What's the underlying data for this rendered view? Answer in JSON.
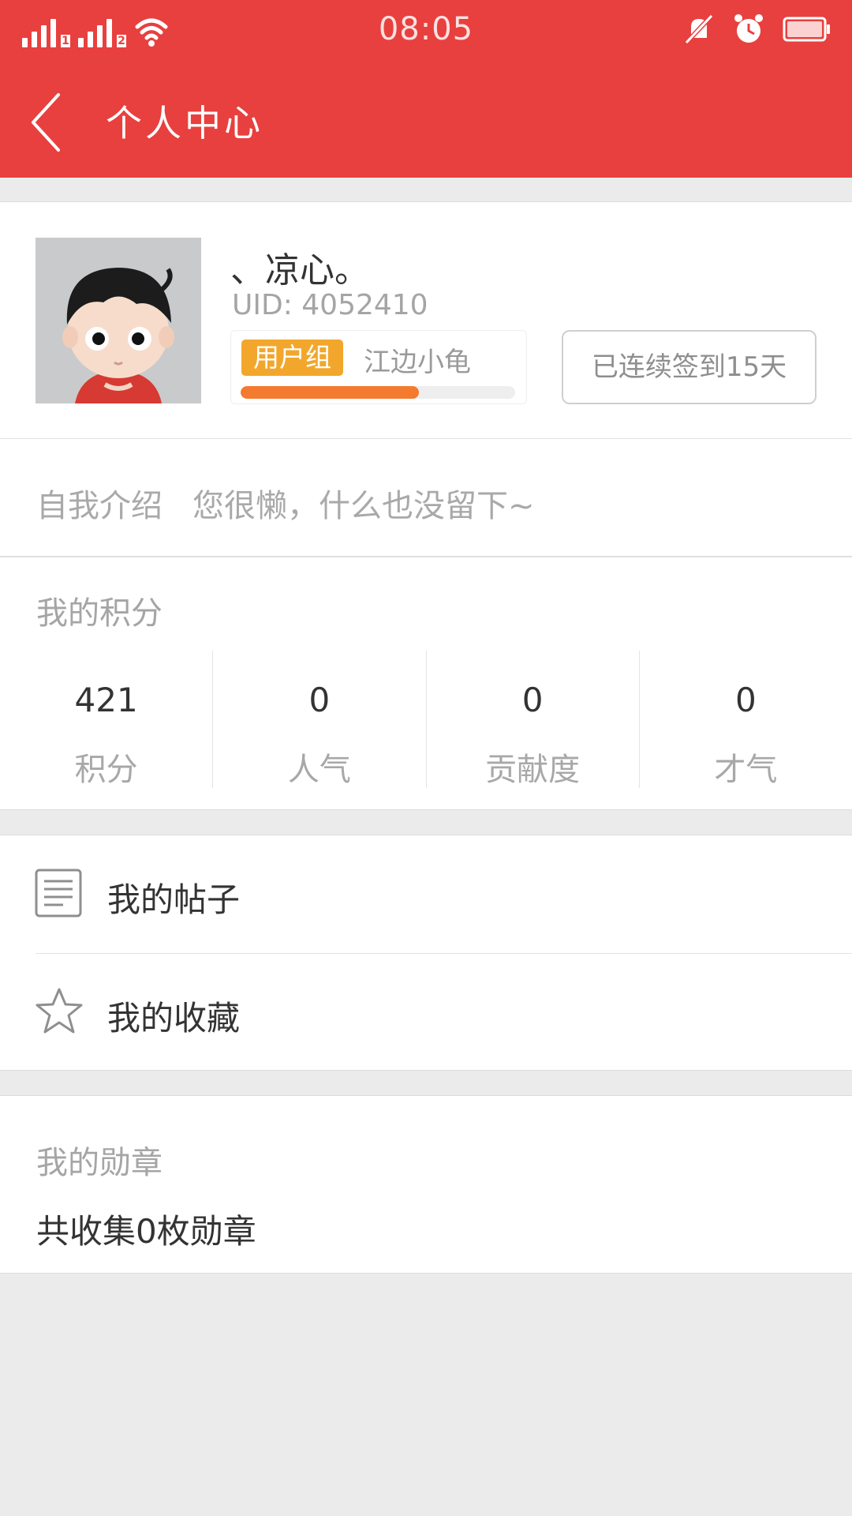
{
  "status_bar": {
    "time": "08:05",
    "sim1": "1",
    "sim2": "2",
    "icons": [
      "signal-icon",
      "wifi-icon",
      "mute-icon",
      "alarm-icon",
      "battery-icon"
    ]
  },
  "app_bar": {
    "title": "个人中心",
    "back_icon": "chevron-left-icon",
    "color": "#e8403e"
  },
  "profile": {
    "nickname": "、凉心。",
    "uid": "UID: 4052410",
    "group_badge": "用户组",
    "group_name": "江边小龟",
    "exp_progress": 0.65,
    "checkin_label": "已连续签到15天",
    "badge_color": "#f2a72c",
    "progress_color": "#f47a30"
  },
  "intro": {
    "label": "自我介绍",
    "text": "您很懒，什么也没留下~"
  },
  "points": {
    "title": "我的积分",
    "stats": [
      {
        "value": "421",
        "label": "积分"
      },
      {
        "value": "0",
        "label": "人气"
      },
      {
        "value": "0",
        "label": "贡献度"
      },
      {
        "value": "0",
        "label": "才气"
      }
    ]
  },
  "menu": {
    "items": [
      {
        "label": "我的帖子",
        "icon": "document-icon"
      },
      {
        "label": "我的收藏",
        "icon": "star-icon"
      }
    ]
  },
  "medals": {
    "title": "我的勋章",
    "text": "共收集0枚勋章"
  }
}
